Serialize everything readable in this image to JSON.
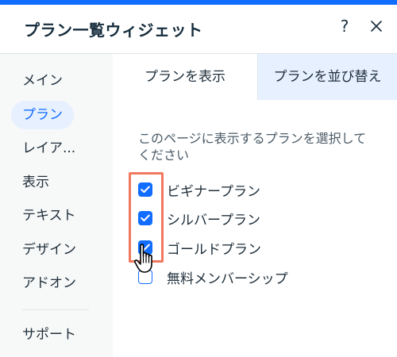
{
  "header": {
    "title": "プラン一覧ウィジェット",
    "help_label": "?"
  },
  "sidebar": {
    "items": [
      {
        "label": "メイン"
      },
      {
        "label": "プラン"
      },
      {
        "label": "レイア..."
      },
      {
        "label": "表示"
      },
      {
        "label": "テキスト"
      },
      {
        "label": "デザイン"
      },
      {
        "label": "アドオン"
      }
    ],
    "support": "サポート",
    "active_index": 1
  },
  "tabs": [
    {
      "label": "プランを表示"
    },
    {
      "label": "プランを並び替え"
    }
  ],
  "main": {
    "description": "このページに表示するプランを選択してください",
    "plans": [
      {
        "label": "ビギナープラン",
        "checked": true
      },
      {
        "label": "シルバープラン",
        "checked": true
      },
      {
        "label": "ゴールドプラン",
        "checked": true
      },
      {
        "label": "無料メンバーシップ",
        "checked": false
      }
    ]
  },
  "colors": {
    "accent": "#116dff",
    "highlight": "#f0785f",
    "active_bg": "#e7f0ff"
  }
}
